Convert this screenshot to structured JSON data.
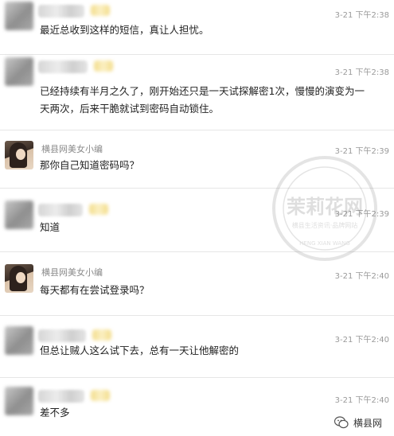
{
  "messages": [
    {
      "sender_name": "",
      "time": "3-21 下午2:38",
      "text": "最近总收到这样的短信，真让人担忧。"
    },
    {
      "sender_name": "",
      "time": "3-21 下午2:38",
      "text": "已经持续有半月之久了，刚开始还只是一天试探解密1次，慢慢的演变为一天两次，后来干脆就试到密码自动锁住。"
    },
    {
      "sender_name": "横县网美女小编",
      "time": "3-21 下午2:39",
      "text": "那你自己知道密码吗？"
    },
    {
      "sender_name": "",
      "time": "3-21 下午2:39",
      "text": "知道"
    },
    {
      "sender_name": "横县网美女小编",
      "time": "3-21 下午2:40",
      "text": "每天都有在尝试登录吗？"
    },
    {
      "sender_name": "",
      "time": "3-21 下午2:40",
      "text": "但总让贼人这么试下去，总有一天让他解密的"
    },
    {
      "sender_name": "",
      "time": "3-21 下午2:40",
      "text": "差不多"
    }
  ],
  "watermark": {
    "title": "茉莉花网",
    "subtitle": "横县生活资讯·品牌网站",
    "bottom": "HENG XIAN WANG"
  },
  "brand": {
    "label": "横县网"
  },
  "icons": {
    "avatar_blurred": "user-avatar-blurred",
    "avatar_editor": "editor-avatar",
    "brand_logo": "wechat-icon"
  }
}
